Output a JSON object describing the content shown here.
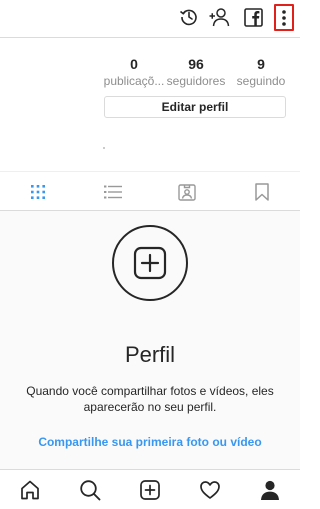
{
  "top_bar": {
    "icons": [
      "history-icon",
      "add-user-icon",
      "facebook-icon",
      "more-options-icon"
    ],
    "highlight_color": "#e0201b"
  },
  "stats": {
    "posts": {
      "value": "0",
      "label": "publicaçõ..."
    },
    "followers": {
      "value": "96",
      "label": "seguidores"
    },
    "following": {
      "value": "9",
      "label": "seguindo"
    }
  },
  "edit_profile_label": "Editar perfil",
  "tabs": {
    "items": [
      "grid-icon",
      "list-icon",
      "tagged-icon",
      "saved-icon"
    ],
    "active": "grid-icon",
    "active_color": "#3897f0"
  },
  "empty_state": {
    "title": "Perfil",
    "description": "Quando você compartilhar fotos e vídeos, eles aparecerão no seu perfil.",
    "link": "Compartilhe sua primeira foto ou vídeo",
    "link_color": "#3897f0"
  },
  "bottom_nav": {
    "items": [
      "home-icon",
      "search-icon",
      "new-post-icon",
      "activity-icon",
      "profile-icon"
    ],
    "active": "profile-icon"
  }
}
